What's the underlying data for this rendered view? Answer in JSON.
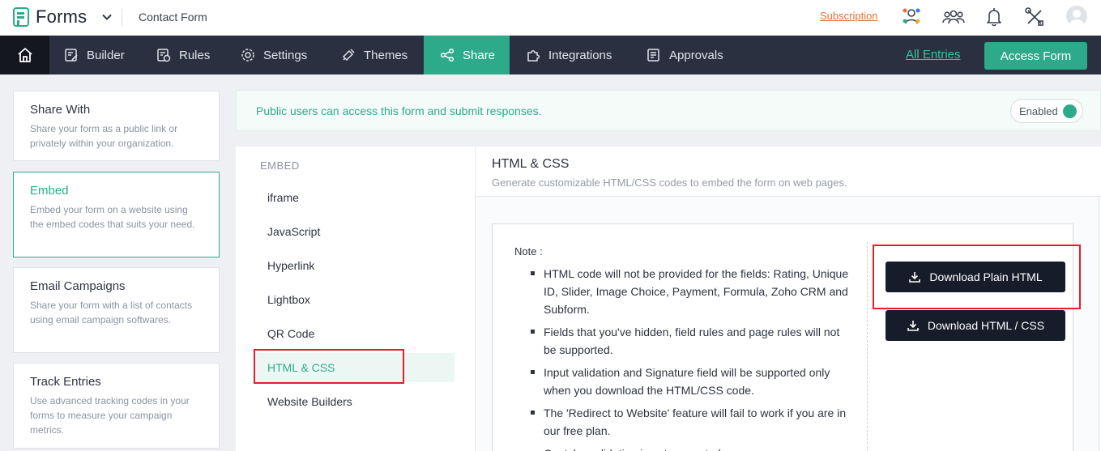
{
  "header": {
    "app_name": "Forms",
    "form_name": "Contact Form",
    "subscription_link": "Subscription",
    "icons": [
      "org-user-icon",
      "users-icon",
      "bell-icon",
      "tools-icon",
      "avatar-icon"
    ]
  },
  "nav": {
    "items": [
      {
        "label": "Builder",
        "icon": "builder-icon"
      },
      {
        "label": "Rules",
        "icon": "rules-icon"
      },
      {
        "label": "Settings",
        "icon": "gear-icon"
      },
      {
        "label": "Themes",
        "icon": "brush-icon"
      },
      {
        "label": "Share",
        "icon": "share-icon",
        "active": true
      },
      {
        "label": "Integrations",
        "icon": "puzzle-icon"
      },
      {
        "label": "Approvals",
        "icon": "approvals-icon"
      }
    ],
    "all_entries_link": "All Entries",
    "access_form_button": "Access Form",
    "active_color": "#2daa8a"
  },
  "sidebar": {
    "cards": [
      {
        "title": "Share With",
        "desc": "Share your form as a public link or privately within your organization."
      },
      {
        "title": "Embed",
        "desc": "Embed your form on a website using the embed codes that suits your need.",
        "active": true
      },
      {
        "title": "Email Campaigns",
        "desc": "Share your form with a list of contacts using email campaign softwares."
      },
      {
        "title": "Track Entries",
        "desc": "Use advanced tracking codes in your forms to measure your campaign metrics."
      }
    ]
  },
  "banner": {
    "text": "Public users can access this form and submit responses.",
    "toggle_label": "Enabled",
    "toggle_on": true
  },
  "embed_menu": {
    "heading": "EMBED",
    "items": [
      "iframe",
      "JavaScript",
      "Hyperlink",
      "Lightbox",
      "QR Code",
      "HTML & CSS",
      "Website Builders"
    ],
    "active": "HTML & CSS"
  },
  "content": {
    "title": "HTML & CSS",
    "subtitle": "Generate customizable HTML/CSS codes to embed the form on web pages.",
    "note_title": "Note :",
    "notes": [
      "HTML code will not be provided for the fields: Rating, Unique ID, Slider, Image Choice, Payment, Formula, Zoho CRM and Subform.",
      "Fields that you've hidden, field rules and page rules will not be supported.",
      "Input validation and Signature field will be supported only when you download the HTML/CSS code.",
      "The 'Redirect to Website' feature will fail to work if you are in our free plan.",
      "Captcha validation is not supported."
    ],
    "download_plain_button": "Download Plain HTML",
    "download_css_button": "Download HTML / CSS"
  }
}
